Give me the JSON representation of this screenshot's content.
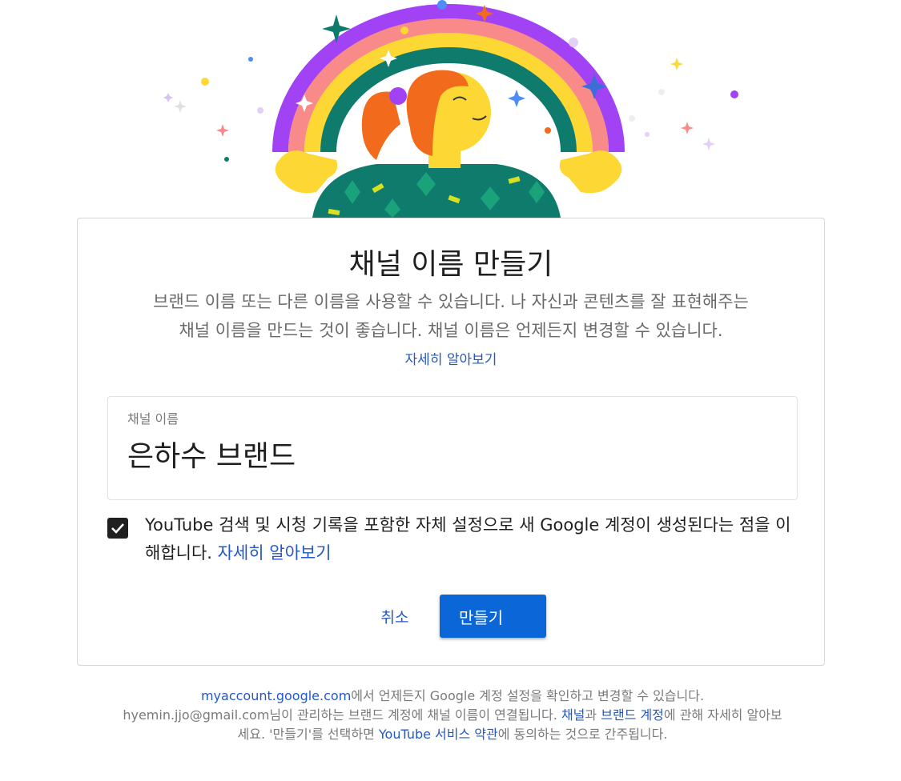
{
  "dialog": {
    "title": "채널 이름 만들기",
    "description_line1": "브랜드 이름 또는 다른 이름을 사용할 수 있습니다. 나 자신과 콘텐츠를 잘 표현해주는",
    "description_line2": "채널 이름을 만드는 것이 좋습니다. 채널 이름은 언제든지 변경할 수 있습니다.",
    "learn_more": "자세히 알아보기",
    "channel_field": {
      "label": "채널 이름",
      "value": "은하수 브랜드"
    },
    "consent": {
      "checked": true,
      "text": "YouTube 검색 및 시청 기록을 포함한 자체 설정으로 새 Google 계정이 생성된다는 점을 이해합니다.",
      "link": "자세히 알아보기"
    },
    "cancel_label": "취소",
    "create_label": "만들기"
  },
  "footer": {
    "account_link": "myaccount.google.com",
    "line1_suffix": "에서 언제든지 Google 계정 설정을 확인하고 변경할 수 있습니다.",
    "email": "hyemin.jjo@gmail.com",
    "line2_mid": "님이 관리하는 브랜드 계정에 채널 이름이 연결됩니다. ",
    "channel_link": "채널",
    "and": "과 ",
    "brand_account_link": "브랜드 계정",
    "line3_prefix": "에 관해 자세히 알아보세요. '만들기'를 선택하면 ",
    "tos_link": "YouTube 서비스 약관",
    "line3_suffix": "에 동의하는 것으로 간주됩니다."
  },
  "colors": {
    "accent": "#0b67d8",
    "link": "#2458c4",
    "rainbow": [
      "#a142f4",
      "#f88a8a",
      "#fdd835",
      "#0f7b6c"
    ]
  }
}
